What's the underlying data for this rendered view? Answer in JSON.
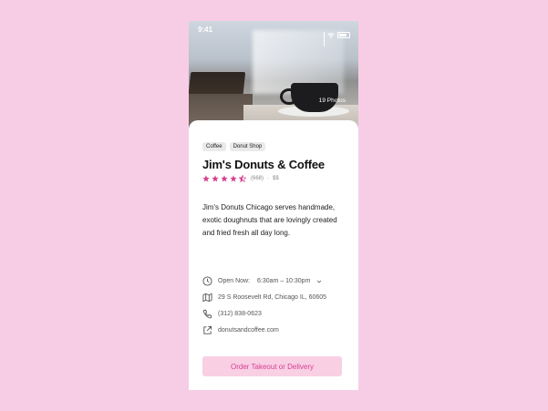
{
  "status_bar": {
    "time": "9:41"
  },
  "hero": {
    "photos_label": "19 Photos"
  },
  "tags": [
    "Coffee",
    "Donut Shop"
  ],
  "place": {
    "name": "Jim's Donuts & Coffee",
    "rating": 4.5,
    "reviews": "(668)",
    "separator": "·",
    "price": "$$",
    "description": "Jim's Donuts Chicago serves handmade, exotic doughnuts that are lovingly created and fried fresh all day long."
  },
  "info": {
    "hours_label": "Open Now:",
    "hours_value": "6:30am – 10:30pm",
    "address": "29 S Roosevelt Rd, Chicago IL, 60605",
    "phone": "(312) 838-0623",
    "website": "donutsandcoffee.com"
  },
  "cta": {
    "label": "Order Takeout or Delivery"
  },
  "colors": {
    "accent": "#d63f91",
    "accent_bg": "#f9cfe4",
    "page_bg": "#f7cde6"
  }
}
